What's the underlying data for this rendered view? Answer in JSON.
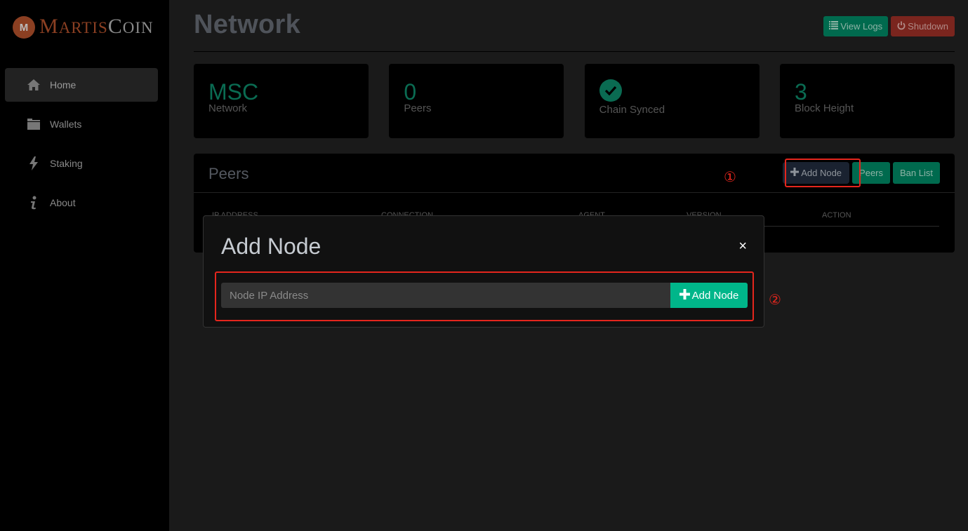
{
  "app": {
    "logo_mark": "M",
    "logo_part1_initial": "M",
    "logo_part1_rest": "ARTIS",
    "logo_part2_initial": "C",
    "logo_part2_rest": "OIN",
    "brand_color": "#8b3f22",
    "accent_color": "#0a6b52"
  },
  "sidebar": {
    "items": [
      {
        "label": "Home",
        "icon": "home-icon",
        "active": true
      },
      {
        "label": "Wallets",
        "icon": "folder-icon",
        "active": false
      },
      {
        "label": "Staking",
        "icon": "bolt-icon",
        "active": false
      },
      {
        "label": "About",
        "icon": "info-icon",
        "active": false
      }
    ]
  },
  "header": {
    "title": "Network",
    "view_logs_label": "View Logs",
    "shutdown_label": "Shutdown"
  },
  "stats": [
    {
      "value": "MSC",
      "label": "Network"
    },
    {
      "value": "0",
      "label": "Peers"
    },
    {
      "value": "",
      "label": "Chain Synced",
      "icon": "check-circle-icon"
    },
    {
      "value": "3",
      "label": "Block Height"
    }
  ],
  "peers": {
    "title": "Peers",
    "add_node_label": "Add Node",
    "peers_label": "Peers",
    "ban_list_label": "Ban List",
    "columns": [
      "IP ADDRESS",
      "CONNECTION",
      "AGENT",
      "VERSION",
      "ACTION"
    ]
  },
  "annotations": {
    "step1": "①",
    "step2": "②"
  },
  "modal": {
    "title": "Add Node",
    "close": "×",
    "input_placeholder": "Node IP Address",
    "input_value": "",
    "submit_label": "Add Node"
  }
}
